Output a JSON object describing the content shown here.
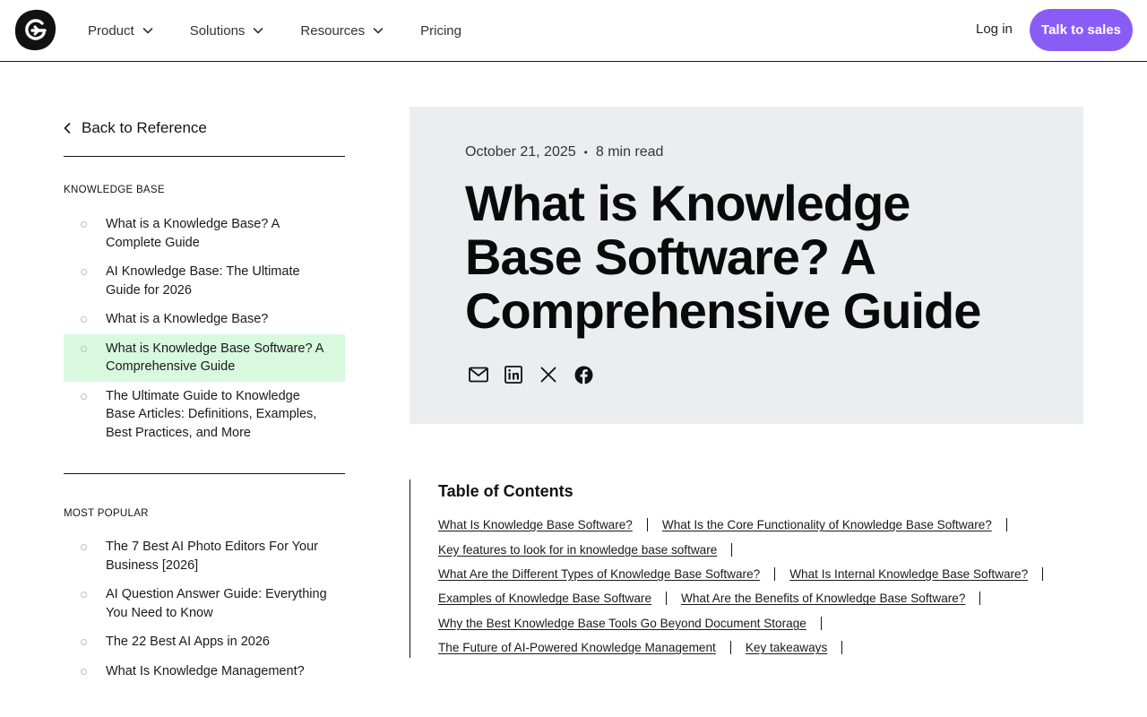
{
  "header": {
    "nav": [
      {
        "label": "Product",
        "dropdown": true
      },
      {
        "label": "Solutions",
        "dropdown": true
      },
      {
        "label": "Resources",
        "dropdown": true
      },
      {
        "label": "Pricing",
        "dropdown": false
      }
    ],
    "login_label": "Log in",
    "cta_label": "Talk to sales",
    "accent_color": "#8a5cf6"
  },
  "sidebar": {
    "back_label": "Back to Reference",
    "knowledge_base": {
      "label": "KNOWLEDGE BASE",
      "items": [
        {
          "label": "What is a Knowledge Base? A Complete Guide",
          "active": false
        },
        {
          "label": "AI Knowledge Base: The Ultimate Guide for 2026",
          "active": false
        },
        {
          "label": "What is a Knowledge Base?",
          "active": false
        },
        {
          "label": "What is Knowledge Base Software? A Comprehensive Guide",
          "active": true
        },
        {
          "label": "The Ultimate Guide to Knowledge Base Articles: Definitions, Examples, Best Practices, and More",
          "active": false
        }
      ]
    },
    "most_popular": {
      "label": "MOST POPULAR",
      "items": [
        {
          "label": "The 7 Best AI Photo Editors For Your Business [2026]"
        },
        {
          "label": "AI Question Answer Guide: Everything You Need to Know"
        },
        {
          "label": "The 22 Best AI Apps in 2026"
        },
        {
          "label": "What Is Knowledge Management?"
        }
      ]
    },
    "active_color": "#d8f9de"
  },
  "article": {
    "date": "October 21, 2025",
    "separator": "•",
    "read_time": "8 min read",
    "title": "What is Knowledge Base Software? A Comprehensive Guide",
    "share_icons": [
      "mail-icon",
      "linkedin-icon",
      "x-icon",
      "facebook-icon"
    ]
  },
  "toc": {
    "title": "Table of Contents",
    "rows": [
      [
        "What Is Knowledge Base Software?",
        "What Is the Core Functionality of Knowledge Base Software?"
      ],
      [
        "Key features to look for in knowledge base software"
      ],
      [
        "What Are the Different Types of Knowledge Base Software?",
        "What Is Internal Knowledge Base Software?"
      ],
      [
        "Examples of Knowledge Base Software",
        "What Are the Benefits of Knowledge Base Software?"
      ],
      [
        "Why the Best Knowledge Base Tools Go Beyond Document Storage"
      ],
      [
        "The Future of AI-Powered Knowledge Management",
        "Key takeaways"
      ]
    ]
  }
}
